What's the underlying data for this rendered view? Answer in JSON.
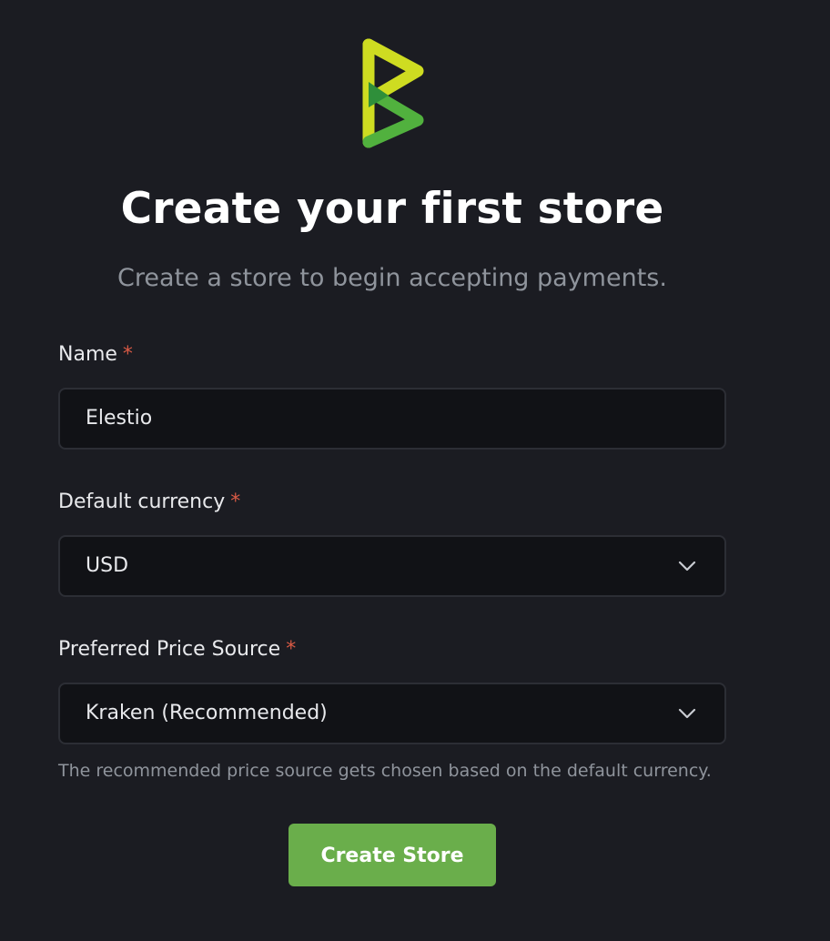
{
  "header": {
    "title": "Create your first store",
    "subtitle": "Create a store to begin accepting payments."
  },
  "form": {
    "name": {
      "label": "Name",
      "required_mark": "*",
      "value": "Elestio"
    },
    "default_currency": {
      "label": "Default currency",
      "required_mark": "*",
      "selected": "USD"
    },
    "price_source": {
      "label": "Preferred Price Source",
      "required_mark": "*",
      "selected": "Kraken (Recommended)",
      "help_text": "The recommended price source gets chosen based on the default currency."
    },
    "submit_label": "Create Store"
  },
  "icons": {
    "logo": "btcpay-logo-icon",
    "select_arrow": "chevron-down-icon"
  },
  "colors": {
    "background": "#1b1c22",
    "accent_green": "#6aae4b",
    "logo_lime": "#cedc21",
    "logo_green": "#51b13e",
    "required_red": "#d95a45",
    "input_bg": "#111216"
  }
}
